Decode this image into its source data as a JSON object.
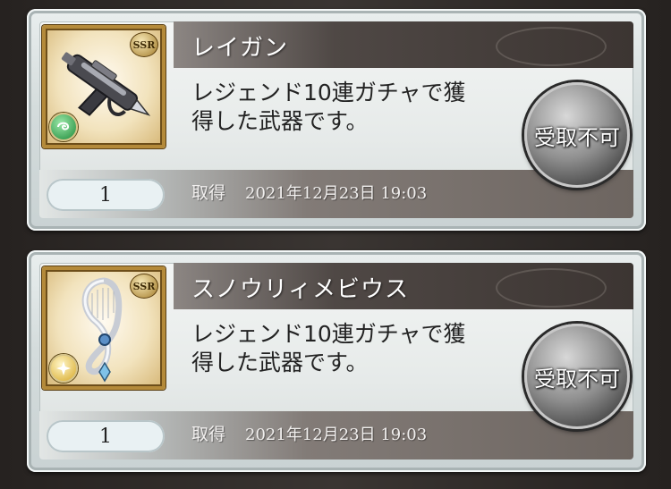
{
  "items": [
    {
      "name": "レイガン",
      "description": "レジェンド10連ガチャで獲\n得した武器です。",
      "rarity": "SSR",
      "element": "wind",
      "weapon_icon": "raygun-icon",
      "quantity": "1",
      "acquired_label": "取得",
      "acquired_date": "2021年12月23日 19:03",
      "claim_label": "受取不可"
    },
    {
      "name": "スノウリィメビウス",
      "description": "レジェンド10連ガチャで獲\n得した武器です。",
      "rarity": "SSR",
      "element": "light",
      "weapon_icon": "mobius-harp-icon",
      "quantity": "1",
      "acquired_label": "取得",
      "acquired_date": "2021年12月23日 19:03",
      "claim_label": "受取不可"
    }
  ],
  "colors": {
    "title_bar": "#3c3532",
    "frame_gold": "#b48a3a",
    "button_dark": "#3b3b3b"
  }
}
